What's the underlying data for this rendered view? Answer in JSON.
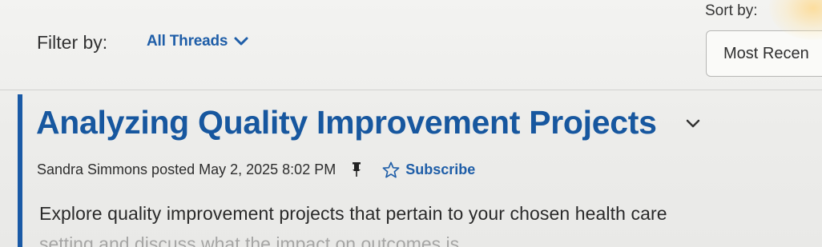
{
  "filter": {
    "label": "Filter by:",
    "value": "All Threads",
    "chevron_icon": "chevron-down-icon"
  },
  "sort": {
    "label": "Sort by:",
    "value": "Most Recen"
  },
  "thread": {
    "title": "Analyzing Quality Improvement Projects",
    "meta": "Sandra Simmons posted May 2, 2025 8:02 PM",
    "pin_icon": "pin-icon",
    "star_icon": "star-outline-icon",
    "subscribe_label": "Subscribe",
    "body": "Explore quality improvement projects that pertain to your chosen health care",
    "body_continued": "setting and discuss what the impact on outcomes is"
  },
  "colors": {
    "accent": "#1a5aa6",
    "link": "#1f5ea8",
    "text": "#2a2a2a"
  }
}
